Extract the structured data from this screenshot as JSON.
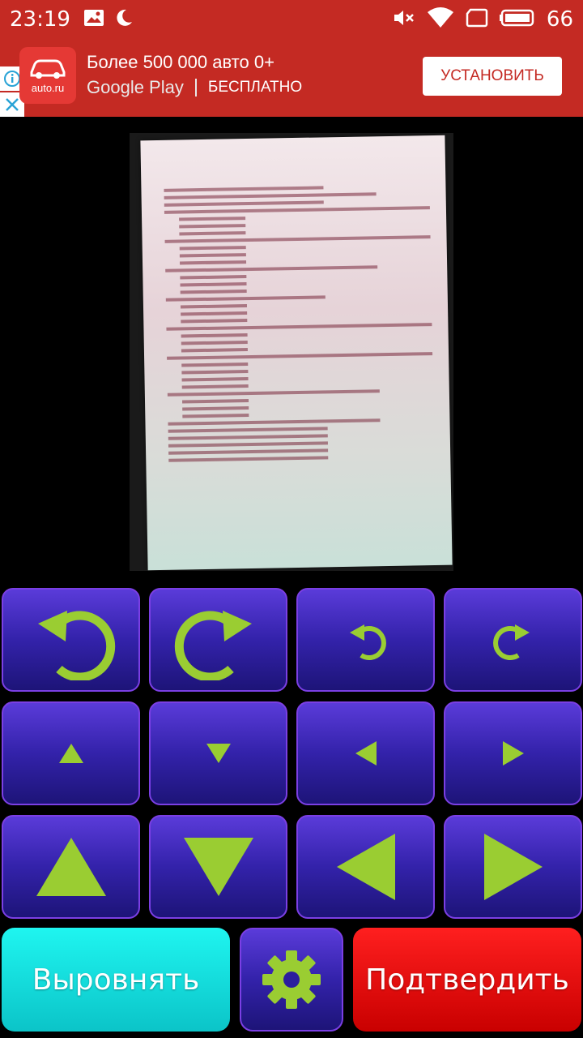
{
  "status_bar": {
    "time": "23:19",
    "battery": "66",
    "icons": [
      "image-icon",
      "moon-icon",
      "mute-icon",
      "wifi-icon",
      "sim-icon",
      "battery-icon"
    ]
  },
  "ad": {
    "app_icon_label": "auto.ru",
    "title": "Более 500 000 авто 0+",
    "store": "Google Play",
    "price": "БЕСПЛАТНО",
    "install_label": "УСТАНОВИТЬ",
    "colors": {
      "background": "#c42a23",
      "button_text": "#c42a23"
    }
  },
  "photo": {
    "description_icon": "document-photo"
  },
  "controls": {
    "rows": [
      [
        "rotate-left-large-icon",
        "rotate-right-large-icon",
        "rotate-left-small-icon",
        "rotate-right-small-icon"
      ],
      [
        "move-up-small-icon",
        "move-down-small-icon",
        "move-left-small-icon",
        "move-right-small-icon"
      ],
      [
        "move-up-large-icon",
        "move-down-large-icon",
        "move-left-large-icon",
        "move-right-large-icon"
      ]
    ],
    "icon_color": "#9acd32",
    "button_color": "#3322aa"
  },
  "bottom": {
    "align_label": "Выровнять",
    "confirm_label": "Подтвердить",
    "settings_icon": "gear-icon",
    "colors": {
      "align": "#0bd6d8",
      "confirm": "#e00000"
    }
  }
}
